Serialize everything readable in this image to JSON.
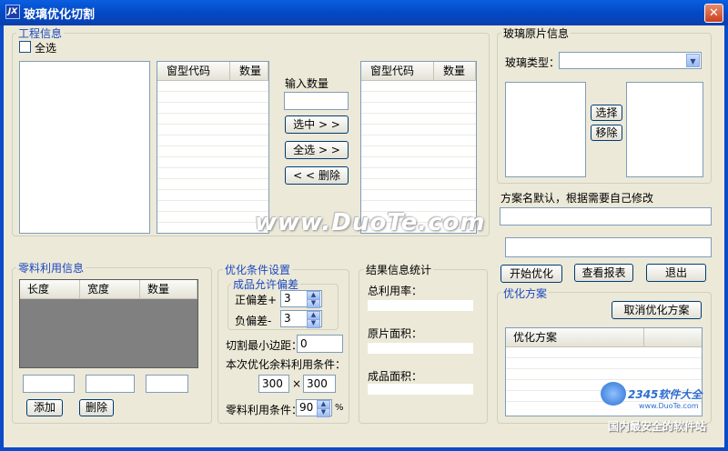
{
  "window": {
    "title": "玻璃优化切割",
    "close": "✕",
    "icon": "JX"
  },
  "project_info": {
    "label": "工程信息",
    "select_all": "全选",
    "left_table": {
      "headers": [
        "窗型代码",
        "数量"
      ]
    },
    "input_qty_label": "输入数量",
    "buttons": {
      "select": "选中 > >",
      "select_all": "全选 > >",
      "remove": "< < 删除"
    },
    "right_table": {
      "headers": [
        "窗型代码",
        "数量"
      ]
    }
  },
  "glass_info": {
    "label": "玻璃原片信息",
    "type_label": "玻璃类型：",
    "choose_btn": "选择",
    "remove_btn": "移除"
  },
  "plan": {
    "name_label": "方案名默认，根据需要自己修改",
    "buttons": {
      "start": "开始优化",
      "report": "查看报表",
      "exit": "退出"
    }
  },
  "remnant": {
    "label": "零料利用信息",
    "headers": [
      "长度",
      "宽度",
      "数量"
    ],
    "add_btn": "添加",
    "delete_btn": "删除"
  },
  "conditions": {
    "label": "优化条件设置",
    "tolerance_label": "成品允许偏差",
    "positive_label": "正偏差+",
    "positive_value": "3",
    "negative_label": "负偏差-",
    "negative_value": "3",
    "min_margin_label": "切割最小边距：",
    "min_margin_value": "0",
    "remnant_cond_label": "本次优化余料利用条件：",
    "remnant_w": "300",
    "remnant_h": "300",
    "times": "×",
    "scrap_label": "零料利用条件：",
    "scrap_value": "90",
    "percent": "%"
  },
  "results": {
    "label": "结果信息统计",
    "total_rate": "总利用率：",
    "raw_area": "原片面积：",
    "product_area": "成品面积："
  },
  "optimization": {
    "label": "优化方案",
    "cancel_btn": "取消优化方案",
    "table_header": "优化方案"
  },
  "watermarks": {
    "duote": "www.DuoTe.com",
    "logo": "2345软件大全",
    "site": "www.DuoTe.com",
    "slogan": "国内最安全的软件站"
  }
}
